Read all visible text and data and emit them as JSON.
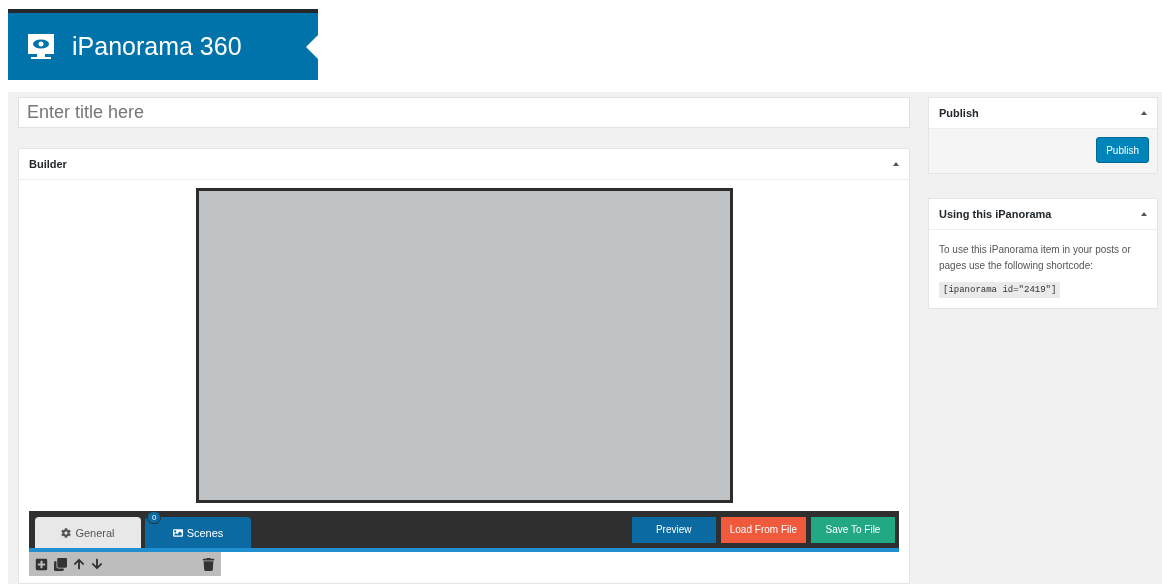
{
  "header": {
    "title": "iPanorama 360"
  },
  "title_field": {
    "placeholder": "Enter title here"
  },
  "builder": {
    "title": "Builder",
    "tabs": [
      {
        "label": "General",
        "selected": false
      },
      {
        "label": "Scenes",
        "selected": true,
        "badge": "0"
      }
    ],
    "actions": [
      {
        "label": "Preview",
        "color": "#0b6aa2"
      },
      {
        "label": "Load From File",
        "color": "#ef5a3c"
      },
      {
        "label": "Save To File",
        "color": "#22a883"
      }
    ]
  },
  "publish": {
    "title": "Publish",
    "button": "Publish"
  },
  "usage": {
    "title": "Using this iPanorama",
    "text": "To use this iPanorama item in your posts or pages use the following shortcode:",
    "shortcode": "[ipanorama id=\"2419\"]"
  }
}
